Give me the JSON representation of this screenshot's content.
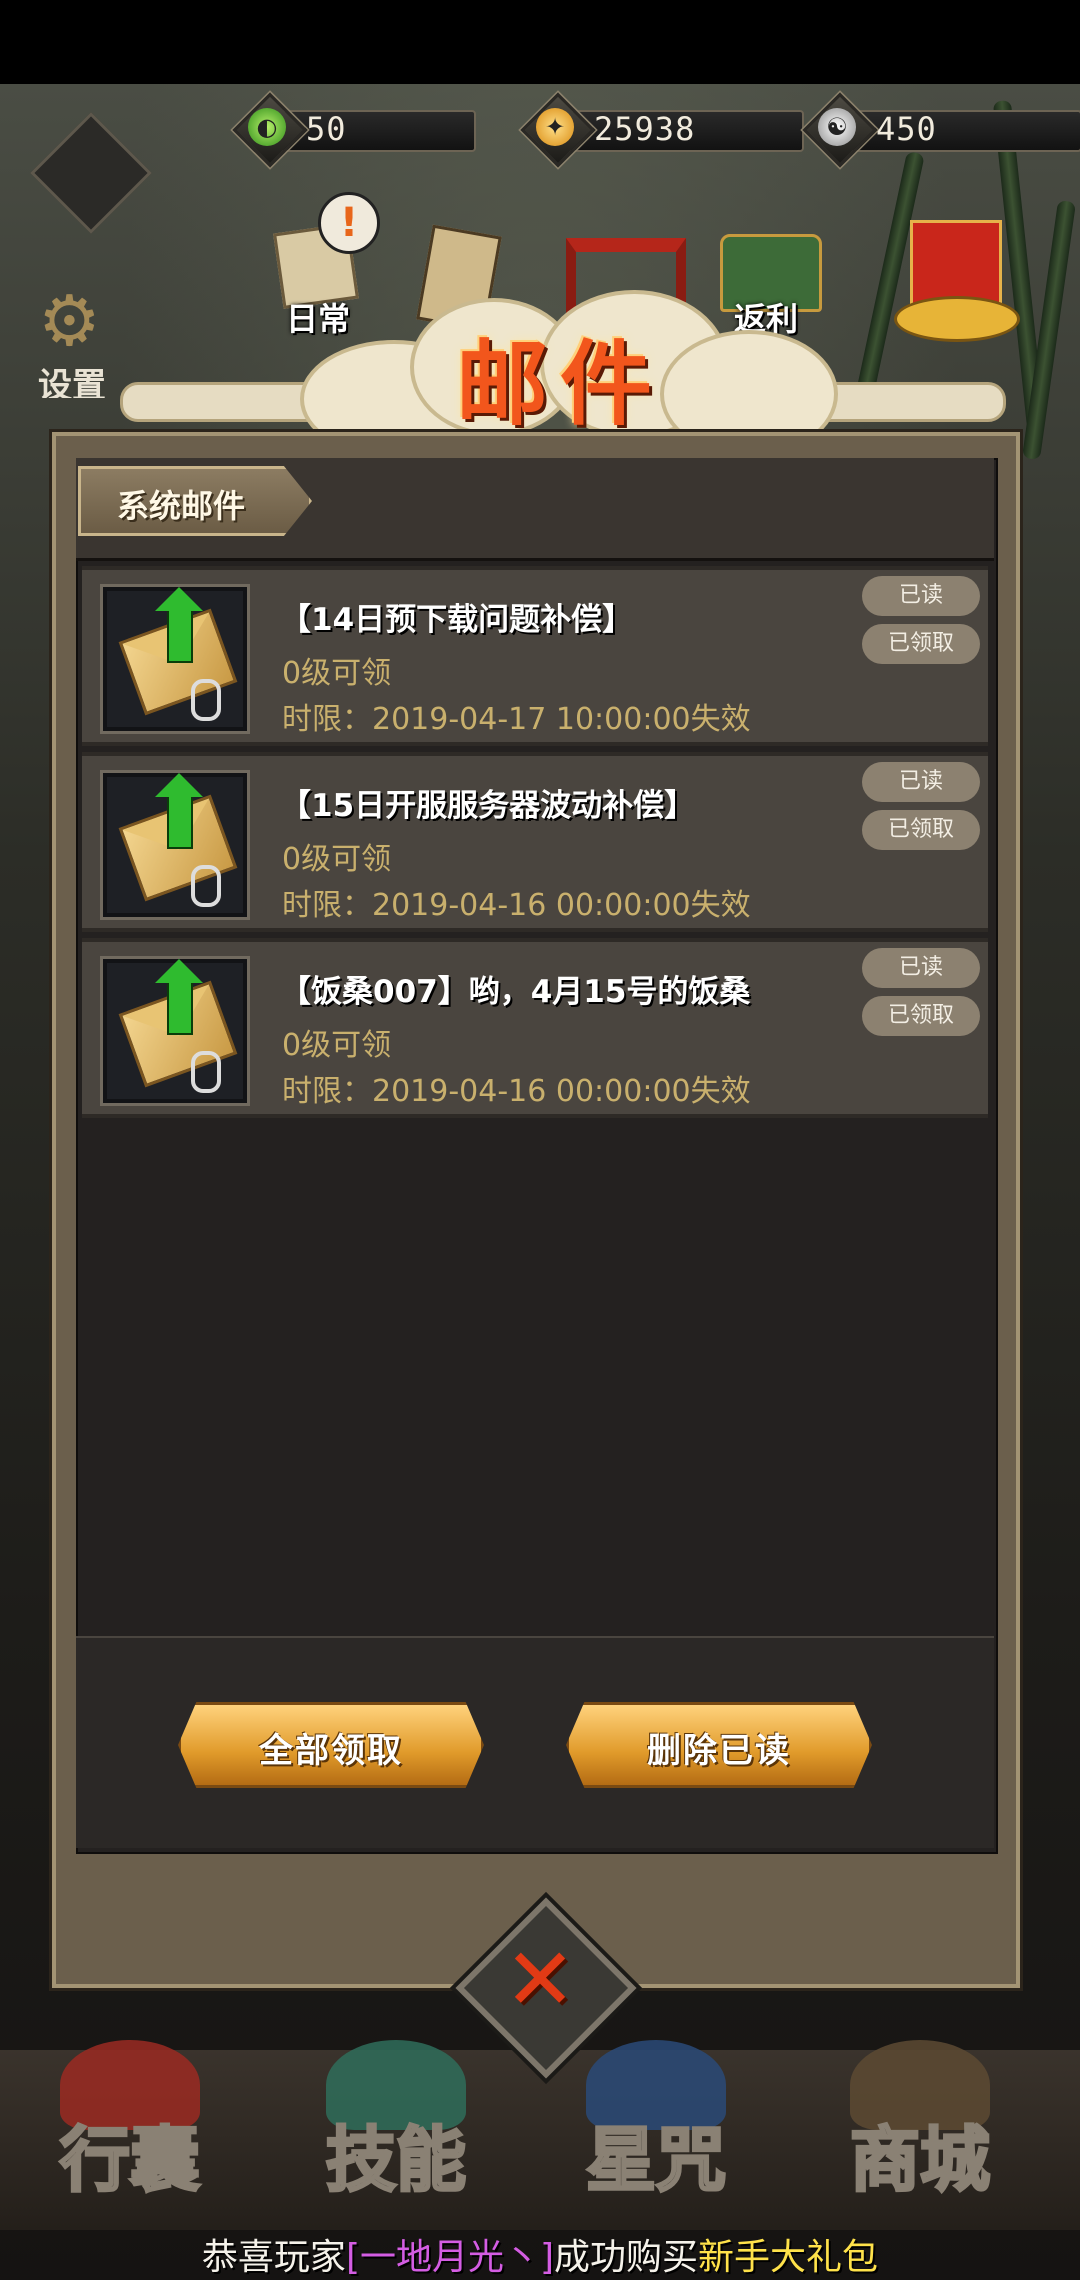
{
  "resources": [
    {
      "icon": "green-jade-icon",
      "value": "50",
      "color": "#58c43a"
    },
    {
      "icon": "gold-coin-icon",
      "value": "25938",
      "color": "#f2a52a"
    },
    {
      "icon": "silver-yinyang-icon",
      "value": "450",
      "color": "#d8d8d8"
    }
  ],
  "left_menu": {
    "settings_label": "设置"
  },
  "top_features": {
    "daily_label": "日常",
    "rebate_label": "返利"
  },
  "window": {
    "title": "邮件"
  },
  "category_tab": "系统邮件",
  "mails": [
    {
      "title": "【14日预下载问题补偿】",
      "level": "0级可领",
      "time": "时限：2019-04-17 10:00:00失效",
      "read": "已读",
      "claimed": "已领取"
    },
    {
      "title": "【15日开服服务器波动补偿】",
      "level": "0级可领",
      "time": "时限：2019-04-16 00:00:00失效",
      "read": "已读",
      "claimed": "已领取"
    },
    {
      "title": "【饭桑007】哟，4月15号的饭桑",
      "level": "0级可领",
      "time": "时限：2019-04-16 00:00:00失效",
      "read": "已读",
      "claimed": "已领取"
    }
  ],
  "actions": {
    "claim_all": "全部领取",
    "delete_read": "删除已读"
  },
  "bottom_nav": [
    "行囊",
    "技能",
    "星咒",
    "商城"
  ],
  "ticker": {
    "prefix": "恭喜玩家",
    "player": "[一地月光丶]",
    "middle": "成功购买",
    "item": "新手大礼包"
  },
  "colors": {
    "title": "#f2561c",
    "accent_gold": "#e09a2a",
    "text_gold": "#c9b06d"
  }
}
